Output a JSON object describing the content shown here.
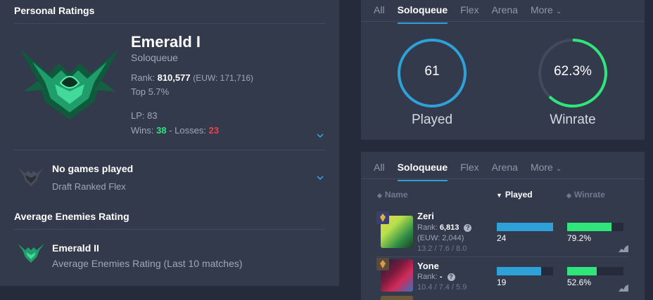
{
  "personal": {
    "title": "Personal Ratings",
    "rank_title": "Emerald I",
    "queue": "Soloqueue",
    "rank_label": "Rank:",
    "rank_value": "810,577",
    "rank_euw": "(EUW: 171,716)",
    "top": "Top 5.7%",
    "lp": "LP: 83",
    "wins_label": "Wins:",
    "wins": "38",
    "losses_label": " - Losses:",
    "losses": "23"
  },
  "flex": {
    "title": "No games played",
    "sub": "Draft Ranked Flex"
  },
  "enemies": {
    "section_title": "Average Enemies Rating",
    "title": "Emerald II",
    "sub": "Average Enemies Rating (Last 10 matches)"
  },
  "top_tabs": [
    "All",
    "Soloqueue",
    "Flex",
    "Arena",
    "More"
  ],
  "stats": {
    "played_value": "61",
    "played_label": "Played",
    "winrate_value": "62.3%",
    "winrate_label": "Winrate",
    "winrate_fraction": 0.623
  },
  "bottom_tabs": [
    "All",
    "Soloqueue",
    "Flex",
    "Arena",
    "More"
  ],
  "table": {
    "headers": {
      "name": "Name",
      "played": "Played",
      "winrate": "Winrate"
    },
    "rows": [
      {
        "name": "Zeri",
        "rank_label": "Rank:",
        "rank": "6,813",
        "euw": "(EUW: 2,044)",
        "kda": "13.2 / 7.6 / 8.0",
        "played": "24",
        "played_frac": 1.0,
        "winrate": "79.2%",
        "winrate_frac": 0.79
      },
      {
        "name": "Yone",
        "rank_label": "Rank:",
        "rank": "-",
        "euw": "",
        "kda": "10.4 / 7.4 / 5.9",
        "played": "19",
        "played_frac": 0.79,
        "winrate": "52.6%",
        "winrate_frac": 0.53
      }
    ]
  },
  "colors": {
    "accent_blue": "#2ea2d8",
    "win_green": "#2ee67a",
    "loss_red": "#f2404a",
    "emerald": "#1f9e6b"
  },
  "icons": {
    "chevron": "chevron-down-icon",
    "help": "help-icon",
    "graph": "graph-icon",
    "sort": "sort-icon"
  }
}
